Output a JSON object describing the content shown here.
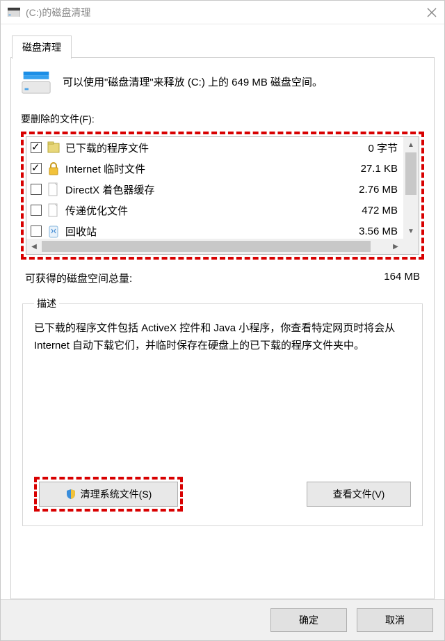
{
  "titlebar": {
    "text": "(C:)的磁盘清理"
  },
  "tab": {
    "label": "磁盘清理"
  },
  "intro": "可以使用\"磁盘清理\"来释放  (C:) 上的 649 MB 磁盘空间。",
  "filesLabel": "要删除的文件(F):",
  "items": [
    {
      "checked": true,
      "icon": "folder",
      "name": "已下载的程序文件",
      "size": "0 字节"
    },
    {
      "checked": true,
      "icon": "lock",
      "name": "Internet 临时文件",
      "size": "27.1 KB"
    },
    {
      "checked": false,
      "icon": "blank",
      "name": "DirectX 着色器缓存",
      "size": "2.76 MB"
    },
    {
      "checked": false,
      "icon": "blank",
      "name": "传递优化文件",
      "size": "472 MB"
    },
    {
      "checked": false,
      "icon": "recycle",
      "name": "回收站",
      "size": "3.56 MB"
    }
  ],
  "totalLabel": "可获得的磁盘空间总量:",
  "totalValue": "164 MB",
  "descLegend": "描述",
  "descText": "已下载的程序文件包括 ActiveX 控件和 Java 小程序，你查看特定网页时将会从 Internet 自动下载它们，并临时保存在硬盘上的已下载的程序文件夹中。",
  "buttons": {
    "cleanSystem": "清理系统文件(S)",
    "viewFiles": "查看文件(V)",
    "ok": "确定",
    "cancel": "取消"
  }
}
